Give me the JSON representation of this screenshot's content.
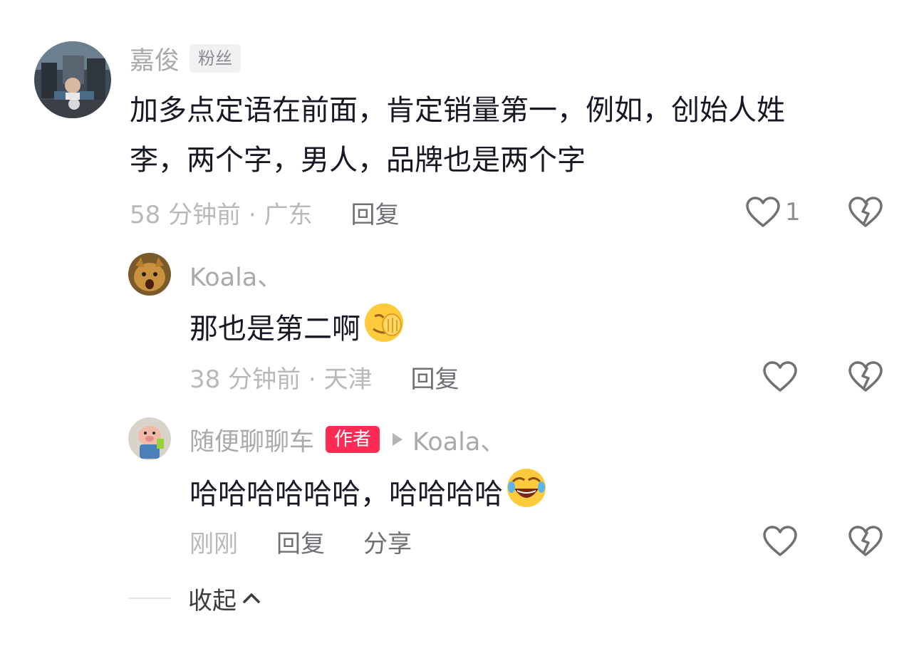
{
  "comments": [
    {
      "author": "嘉俊",
      "badge": "粉丝",
      "text": "加多点定语在前面，肯定销量第一，例如，创始人姓李，两个字，男人，品牌也是两个字",
      "text_line1": "加多点定语在前面，肯定销量第一，例如，创始人姓",
      "text_line2": "李，两个字，男人，品牌也是两个字",
      "meta": "58 分钟前 · 广东",
      "reply_label": "回复",
      "like_count": "1"
    },
    {
      "author": "Koala、",
      "text": "那也是第二啊",
      "emoji": "face-palm-emoji",
      "meta": "38 分钟前 · 天津",
      "reply_label": "回复"
    },
    {
      "author": "随便聊聊车",
      "badge": "作者",
      "reply_to": "Koala、",
      "text": "哈哈哈哈哈哈，哈哈哈哈",
      "emoji": "rolling-laughing-emoji",
      "meta": "刚刚",
      "reply_label": "回复",
      "share_label": "分享"
    }
  ],
  "collapse_label": "收起",
  "colors": {
    "author_badge": "#fe2c55",
    "text": "#161823",
    "muted": "#a9a9ae"
  }
}
